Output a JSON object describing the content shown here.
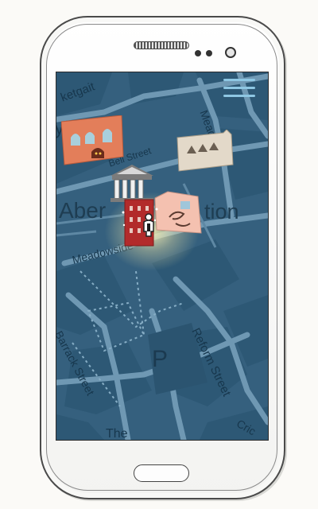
{
  "map": {
    "labels": {
      "ketgait": "ketgait",
      "meadow_top": "Meadow",
      "bell_street": "Bell Street",
      "aber": "Aber",
      "tion": "tion",
      "meadowside": "Meadowside",
      "barrack_street": "Barrack Street",
      "reform_street": "Reform Street",
      "parking": "P",
      "bottom_the": "The",
      "bottom_cric": "Cric",
      "left_y": "y"
    },
    "colors": {
      "water": "#35607e",
      "block": "#2f5a77",
      "road": "#6f98b3",
      "label": "#17374d"
    }
  },
  "menu": {
    "icon": "hamburger-menu-icon"
  },
  "pois": [
    {
      "name": "poi-arched-building",
      "icon": "arched-building-icon",
      "color": "#e37e5a"
    },
    {
      "name": "poi-castle-wall",
      "icon": "castle-wall-icon",
      "color": "#e3d9c9"
    },
    {
      "name": "poi-museum",
      "icon": "museum-columns-icon",
      "color": "#7b7b7b"
    },
    {
      "name": "poi-pink-building",
      "icon": "pink-building-icon",
      "color": "#f4c1b0"
    },
    {
      "name": "poi-red-shop",
      "icon": "red-shop-icon",
      "color": "#b22b2b"
    }
  ],
  "user_marker": {
    "icon": "user-location-icon"
  }
}
